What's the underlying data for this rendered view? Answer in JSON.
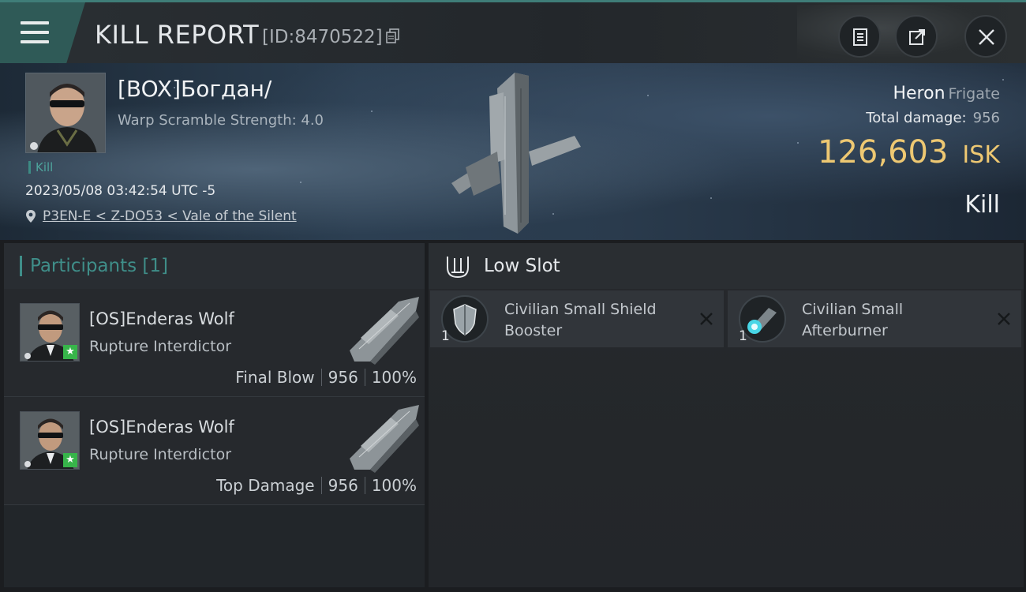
{
  "header": {
    "title": "KILL REPORT",
    "report_id": "[ID:8470522]"
  },
  "victim": {
    "name": "[BOX]Богдан/",
    "warp_scramble": "Warp Scramble Strength: 4.0",
    "kill_tag": "Kill",
    "timestamp": "2023/05/08 03:42:54 UTC -5",
    "location": "P3EN-E < Z-DO53 < Vale of the Silent",
    "ship_name": "Heron",
    "ship_class": "Frigate",
    "total_damage_label": "Total damage:",
    "total_damage": "956",
    "isk_value": "126,603",
    "isk_unit": "ISK",
    "result": "Kill"
  },
  "participants": {
    "title": "Participants",
    "count": "[1]",
    "rows": [
      {
        "name": "[OS]Enderas Wolf",
        "ship": "Rupture Interdictor",
        "role": "Final Blow",
        "damage": "956",
        "percent": "100%"
      },
      {
        "name": "[OS]Enderas Wolf",
        "ship": "Rupture Interdictor",
        "role": "Top Damage",
        "damage": "956",
        "percent": "100%"
      }
    ]
  },
  "modules": {
    "slot_title": "Low Slot",
    "items": [
      {
        "name": "Civilian Small Shield Booster",
        "qty": "1",
        "icon": "shield-booster-icon"
      },
      {
        "name": "Civilian Small Afterburner",
        "qty": "1",
        "icon": "afterburner-icon"
      }
    ]
  },
  "colors": {
    "accent_teal": "#3f8e89",
    "isk_gold": "#eec872",
    "badge_green": "#37b54a"
  }
}
